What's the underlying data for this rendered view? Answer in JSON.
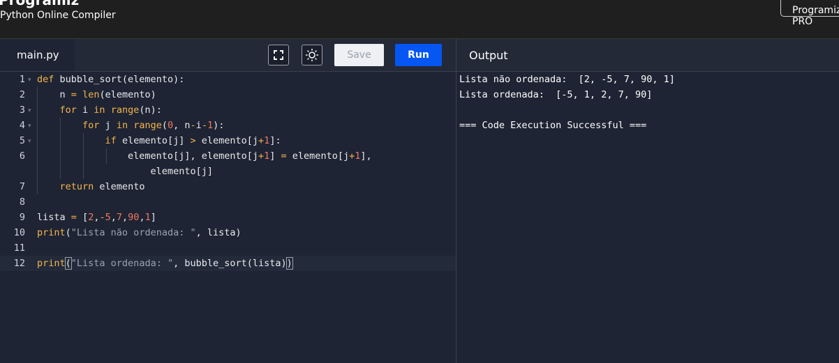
{
  "header": {
    "brand": "Programiz",
    "subtitle": "Python Online Compiler",
    "pro_button": "Programiz PRO"
  },
  "editor": {
    "tab_label": "main.py",
    "save_label": "Save",
    "run_label": "Run",
    "line_numbers": [
      "1",
      "2",
      "3",
      "4",
      "5",
      "6",
      "7",
      "8",
      "9",
      "10",
      "11",
      "12"
    ],
    "active_line": 12,
    "code": [
      "def bubble_sort(elemento):",
      "    n = len(elemento)",
      "    for i in range(n):",
      "        for j in range(0, n-i-1):",
      "            if elemento[j] > elemento[j+1]:",
      "                elemento[j], elemento[j+1] = elemento[j+1],",
      "                    elemento[j]",
      "    return elemento",
      "",
      "lista = [2,-5,7,90,1]",
      "print(\"Lista não ordenada: \", lista)",
      "",
      "print(\"Lista ordenada: \", bubble_sort(lista))"
    ]
  },
  "output": {
    "title": "Output",
    "lines": [
      "Lista não ordenada:  [2, -5, 7, 90, 1]",
      "Lista ordenada:  [-5, 1, 2, 7, 90]",
      "",
      "=== Code Execution Successful ==="
    ]
  },
  "colors": {
    "run_button": "#0556f3",
    "keyword": "#f6b44e",
    "number": "#f07860",
    "string": "#9aa3b0"
  },
  "icons": [
    "fullscreen-icon",
    "theme-sun-icon",
    "fold-arrow-icon"
  ]
}
